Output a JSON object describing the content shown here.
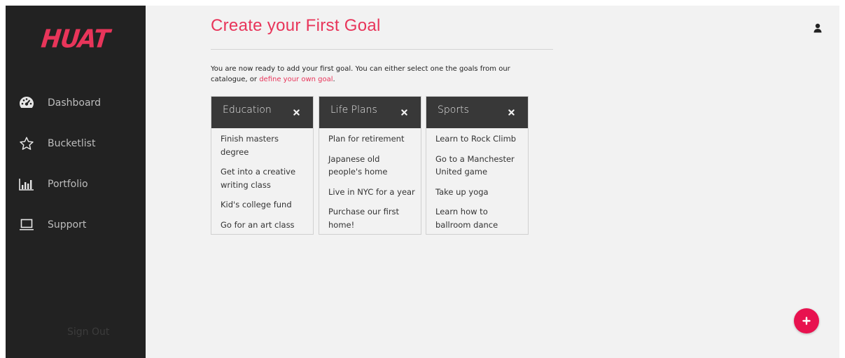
{
  "brand": {
    "logo_text": "HUAT",
    "accent_color": "#e8355a"
  },
  "sidebar": {
    "items": [
      {
        "label": "Dashboard",
        "icon": "dashboard-gauge-icon"
      },
      {
        "label": "Bucketlist",
        "icon": "star-outline-icon"
      },
      {
        "label": "Portfolio",
        "icon": "bar-chart-icon"
      },
      {
        "label": "Support",
        "icon": "laptop-icon"
      }
    ],
    "signout_label": "Sign Out"
  },
  "header": {
    "title": "Create your First Goal",
    "user_icon": "user-icon"
  },
  "intro": {
    "text_before": "You are now ready to add your first goal. You can either select one the goals from our catalogue, or ",
    "link_text": "define your own goal",
    "text_after": "."
  },
  "categories": [
    {
      "name": "Education",
      "goals": [
        "Finish masters degree",
        "Get into a creative writing class",
        "Kid's college fund",
        "Go for an art class"
      ]
    },
    {
      "name": "Life Plans",
      "goals": [
        "Plan for retirement",
        "Japanese old people's home",
        "Live in NYC for a year",
        "Purchase our first home!"
      ]
    },
    {
      "name": "Sports",
      "goals": [
        "Learn to Rock Climb",
        "Go to a Manchester United game",
        "Take up yoga",
        "Learn how to ballroom dance"
      ]
    }
  ],
  "fab": {
    "icon": "plus-icon",
    "color": "#e8124f"
  }
}
